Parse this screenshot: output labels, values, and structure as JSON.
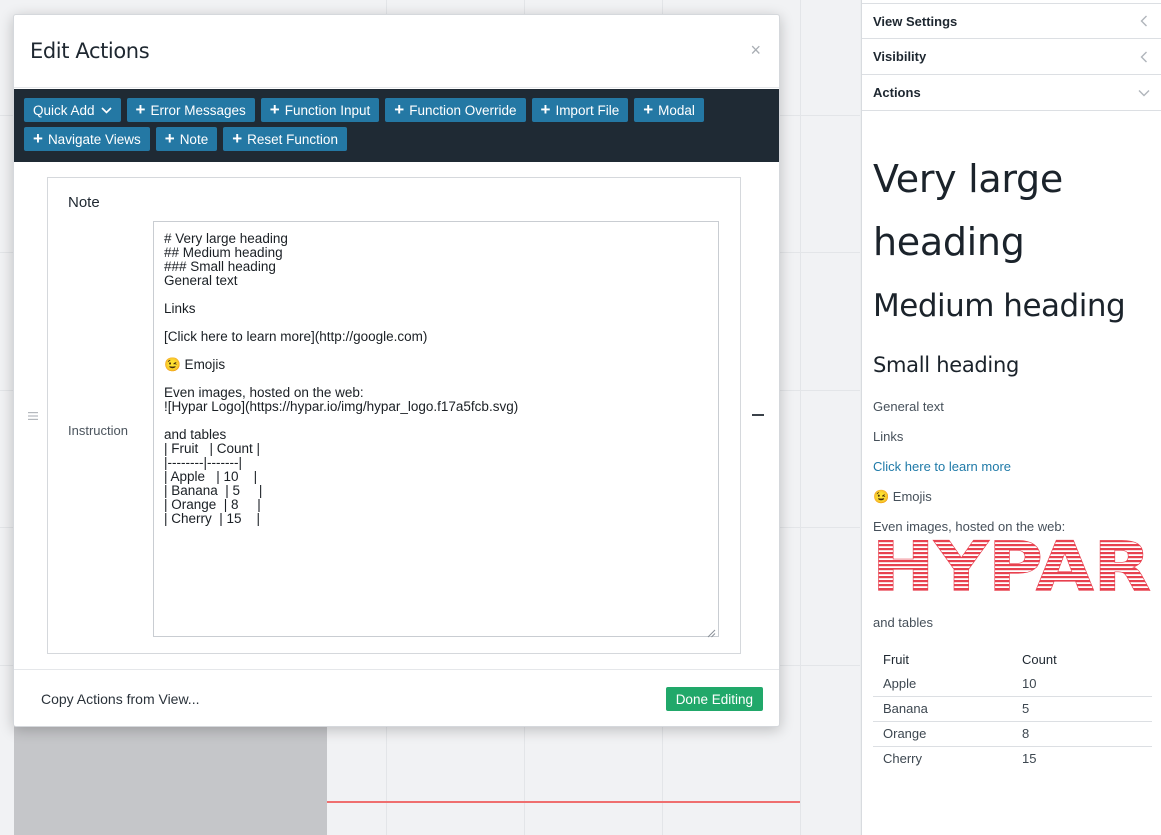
{
  "modal": {
    "title": "Edit Actions",
    "close_glyph": "×",
    "toolbar": {
      "row1": [
        {
          "label": "Quick Add",
          "dropdown": true
        },
        {
          "label": "Error Messages",
          "plus": true
        },
        {
          "label": "Function Input",
          "plus": true
        },
        {
          "label": "Function Override",
          "plus": true
        },
        {
          "label": "Import File",
          "plus": true
        },
        {
          "label": "Modal",
          "plus": true
        }
      ],
      "row2": [
        {
          "label": "Navigate Views",
          "plus": true
        },
        {
          "label": "Note",
          "plus": true
        },
        {
          "label": "Reset Function",
          "plus": true
        }
      ]
    },
    "card": {
      "title": "Note",
      "field_label": "Instruction",
      "textarea_value": "# Very large heading\n## Medium heading\n### Small heading\nGeneral text\n\nLinks\n\n[Click here to learn more](http://google.com)\n\n😉 Emojis\n\nEven images, hosted on the web:\n![Hypar Logo](https://hypar.io/img/hypar_logo.f17a5fcb.svg)\n\nand tables\n| Fruit   | Count |\n|--------|-------|\n| Apple   | 10    |\n| Banana  | 5     |\n| Orange  | 8     |\n| Cherry  | 15    |"
    },
    "footer": {
      "copy_label": "Copy Actions from View...",
      "done_label": "Done Editing"
    }
  },
  "panel": {
    "sections": [
      {
        "label": "View Settings",
        "state": "collapsed"
      },
      {
        "label": "Visibility",
        "state": "collapsed"
      },
      {
        "label": "Actions",
        "state": "expanded"
      }
    ],
    "preview": {
      "h1": "Very large heading",
      "h2": "Medium heading",
      "h3": "Small heading",
      "general": "General text",
      "links": "Links",
      "link_text": "Click here to learn more",
      "emoji_line": "😉 Emojis",
      "images_line": "Even images, hosted on the web:",
      "logo_text": "HYPAR",
      "tables_line": "and tables",
      "table": {
        "headers": [
          "Fruit",
          "Count"
        ],
        "rows": [
          [
            "Apple",
            "10"
          ],
          [
            "Banana",
            "5"
          ],
          [
            "Orange",
            "8"
          ],
          [
            "Cherry",
            "15"
          ]
        ]
      }
    }
  },
  "colors": {
    "toolbar_bg": "#1f2a34",
    "toolbar_button": "#2478a4",
    "done_button": "#21a86a",
    "link": "#1f7aa8",
    "logo": "#e8414f"
  }
}
